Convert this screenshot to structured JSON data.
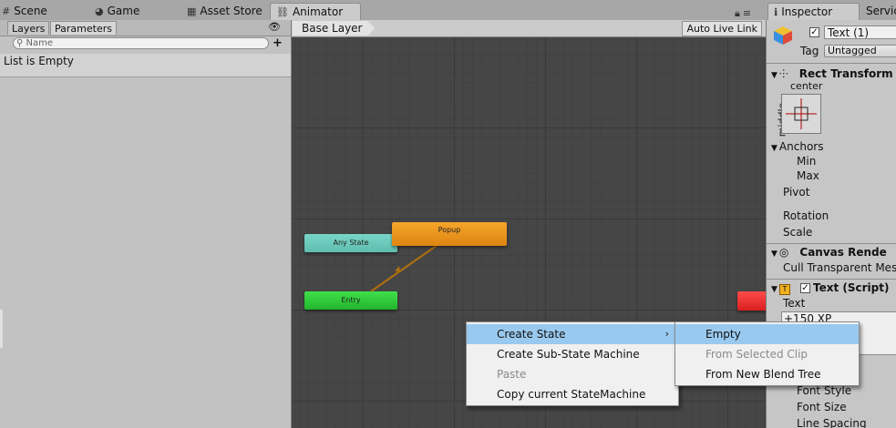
{
  "top_tabs": [
    {
      "icon": "scene-icon",
      "glyph": "#",
      "label": "Scene"
    },
    {
      "icon": "game-icon",
      "glyph": "◕",
      "label": "Game"
    },
    {
      "icon": "asset-store-icon",
      "glyph": "▦",
      "label": "Asset Store"
    },
    {
      "icon": "animator-icon",
      "glyph": "⛓",
      "label": "Animator"
    }
  ],
  "left_panel": {
    "tabs": [
      "Layers",
      "Parameters"
    ],
    "search_placeholder": "Name",
    "empty_text": "List is Empty"
  },
  "graph": {
    "breadcrumb": "Base Layer",
    "auto_live_link": "Auto Live Link",
    "nodes": {
      "any_state": "Any State",
      "popup": "Popup",
      "entry": "Entry"
    }
  },
  "inspector": {
    "tabs": [
      "Inspector",
      "Servic"
    ],
    "object_name": "Text (1)",
    "tag_label": "Tag",
    "tag_value": "Untagged",
    "rect_transform": "Rect Transform",
    "anchor_h": "center",
    "anchor_v": "middle",
    "anchors": "Anchors",
    "min": "Min",
    "max": "Max",
    "pivot": "Pivot",
    "rotation": "Rotation",
    "scale": "Scale",
    "canvas_renderer": "Canvas Rende",
    "cull_transparent": "Cull Transparent Mesh",
    "text_script": "Text (Script)",
    "text_label": "Text",
    "text_value": "+150 XP",
    "font_style": "Font Style",
    "font_size": "Font Size",
    "line_spacing": "Line Spacing"
  },
  "context_menu": {
    "items": [
      {
        "label": "Create State",
        "has_submenu": true,
        "highlighted": true,
        "disabled": false
      },
      {
        "label": "Create Sub-State Machine",
        "has_submenu": false,
        "highlighted": false,
        "disabled": false
      },
      {
        "label": "Paste",
        "has_submenu": false,
        "highlighted": false,
        "disabled": true
      },
      {
        "label": "Copy current StateMachine",
        "has_submenu": false,
        "highlighted": false,
        "disabled": false
      }
    ],
    "submenu": [
      {
        "label": "Empty",
        "highlighted": true,
        "disabled": false
      },
      {
        "label": "From Selected Clip",
        "highlighted": false,
        "disabled": true
      },
      {
        "label": "From New Blend Tree",
        "highlighted": false,
        "disabled": false
      }
    ]
  },
  "colors": {
    "any_state": "#6cc9bb",
    "popup": "#ea9520",
    "entry": "#30cb3b",
    "exit": "#e33030",
    "transition": "#b07010",
    "menu_highlight": "#99c9ef"
  }
}
